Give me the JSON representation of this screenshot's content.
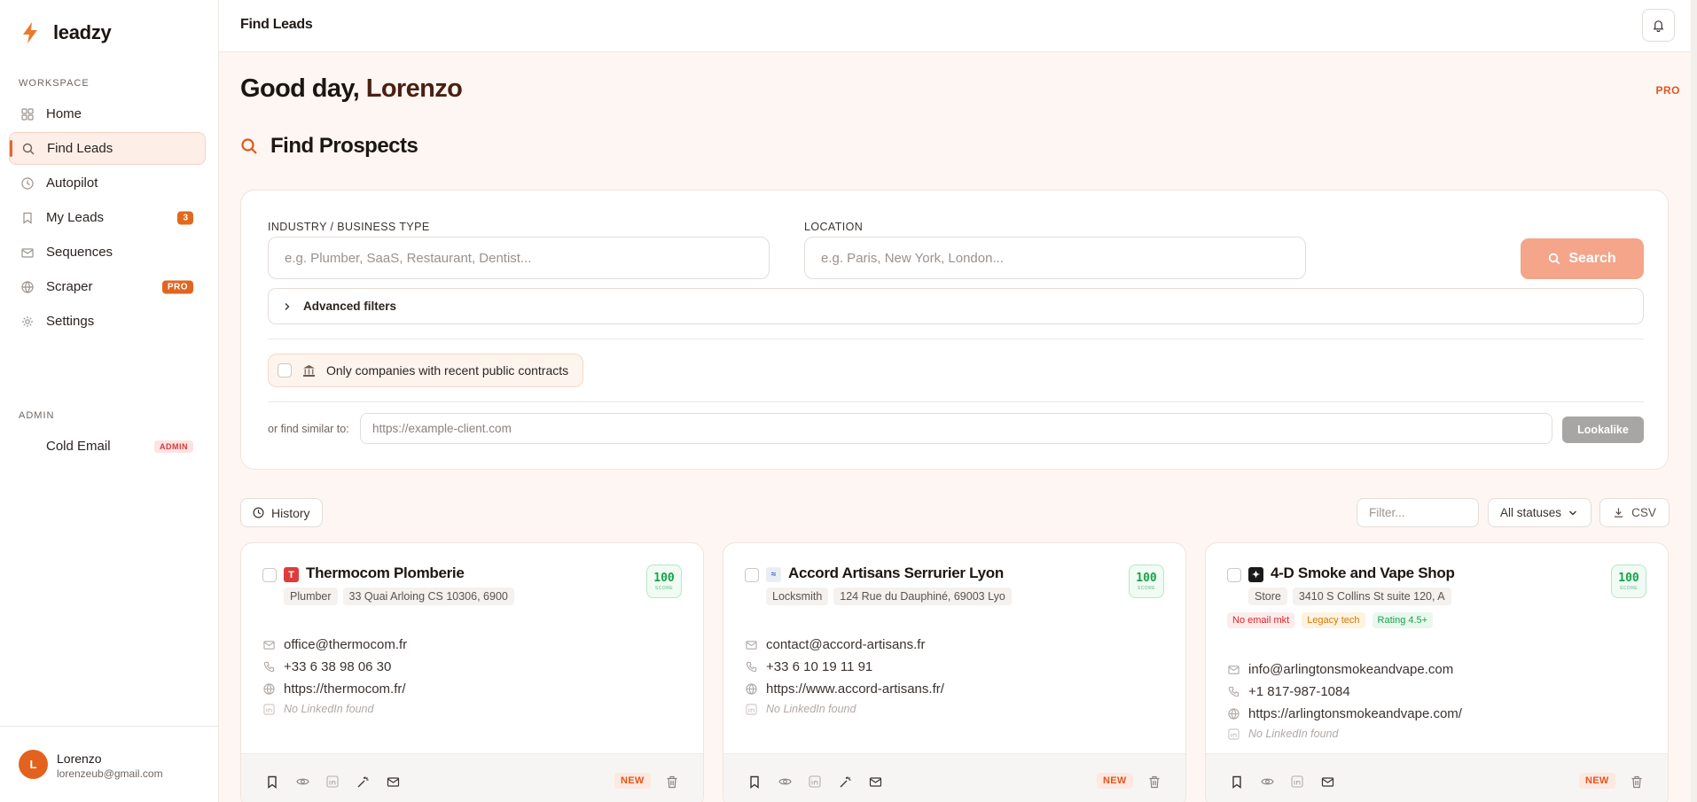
{
  "app": {
    "name": "leadzy",
    "accent": "#e5652f"
  },
  "sidebar": {
    "workspace_label": "WORKSPACE",
    "items": [
      {
        "label": "Home",
        "icon": "grid-icon"
      },
      {
        "label": "Find Leads",
        "icon": "search-icon",
        "active": true
      },
      {
        "label": "Autopilot",
        "icon": "clock-icon"
      },
      {
        "label": "My Leads",
        "icon": "bookmark-icon",
        "badge": "3"
      },
      {
        "label": "Sequences",
        "icon": "mail-icon"
      },
      {
        "label": "Scraper",
        "icon": "globe-icon",
        "badge": "PRO"
      },
      {
        "label": "Settings",
        "icon": "gear-icon"
      }
    ],
    "admin_label": "ADMIN",
    "admin_items": [
      {
        "label": "Cold Email",
        "badge": "ADMIN"
      }
    ],
    "user": {
      "initial": "L",
      "name": "Lorenzo",
      "email": "lorenzeub@gmail.com"
    }
  },
  "topbar": {
    "title": "Find Leads"
  },
  "main": {
    "greeting_prefix": "Good day, ",
    "greeting_name": "Lorenzo",
    "plan": "PRO",
    "section_title": "Find Prospects"
  },
  "search": {
    "industry_label": "INDUSTRY / BUSINESS TYPE",
    "industry_placeholder": "e.g. Plumber, SaaS, Restaurant, Dentist...",
    "location_label": "LOCATION",
    "location_placeholder": "e.g. Paris, New York, London...",
    "search_button": "Search",
    "advanced_filters": "Advanced filters",
    "contracts_filter": "Only companies with recent public contracts",
    "similar_label": "or find similar to:",
    "similar_placeholder": "https://example-client.com",
    "lookalike_button": "Lookalike"
  },
  "toolbar": {
    "history": "History",
    "filter_placeholder": "Filter...",
    "status_select": "All statuses",
    "csv": "CSV"
  },
  "leads": [
    {
      "name": "Thermocom Plomberie",
      "logo_color": "#e03b3b",
      "category": "Plumber",
      "address": "33 Quai Arloing CS 10306, 6900",
      "score": "100",
      "score_label": "SCORE",
      "tags": [],
      "email": "office@thermocom.fr",
      "phone": "+33 6 38 98 06 30",
      "website": "https://thermocom.fr/",
      "linkedin": "No LinkedIn found",
      "status": "NEW"
    },
    {
      "name": "Accord Artisans Serrurier Lyon",
      "logo_color": "#3c6fb5",
      "category": "Locksmith",
      "address": "124 Rue du Dauphiné, 69003 Lyo",
      "score": "100",
      "score_label": "SCORE",
      "tags": [],
      "email": "contact@accord-artisans.fr",
      "phone": "+33 6 10 19 11 91",
      "website": "https://www.accord-artisans.fr/",
      "linkedin": "No LinkedIn found",
      "status": "NEW"
    },
    {
      "name": "4-D Smoke and Vape Shop",
      "logo_color": "#1a1a1a",
      "category": "Store",
      "address": "3410 S Collins St suite 120, A",
      "score": "100",
      "score_label": "SCORE",
      "tags": [
        {
          "label": "No email mkt",
          "tone": "red"
        },
        {
          "label": "Legacy tech",
          "tone": "orange"
        },
        {
          "label": "Rating 4.5+",
          "tone": "green"
        }
      ],
      "email": "info@arlingtonsmokeandvape.com",
      "phone": "+1 817-987-1084",
      "website": "https://arlingtonsmokeandvape.com/",
      "linkedin": "No LinkedIn found",
      "status": "NEW"
    }
  ]
}
